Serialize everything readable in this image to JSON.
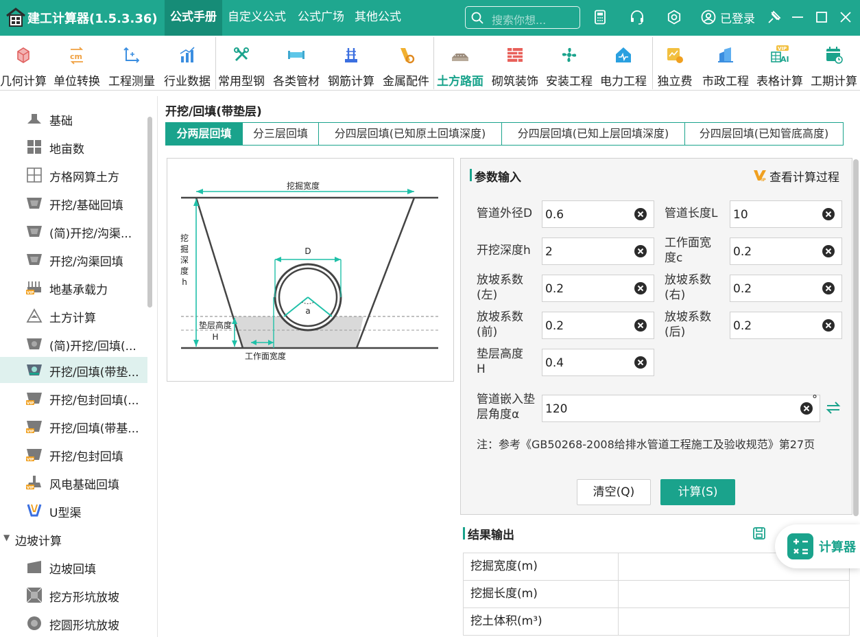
{
  "app": {
    "title": "建工计算器(1.5.3.36)"
  },
  "nav": {
    "tabs": [
      {
        "label": "公式手册"
      },
      {
        "label": "自定义公式"
      },
      {
        "label": "公式广场"
      },
      {
        "label": "其他公式"
      }
    ],
    "search_placeholder": "搜索你想...",
    "login_label": "已登录"
  },
  "toolbar": {
    "items": [
      {
        "label": "几何计算",
        "icon": "geometry-icon"
      },
      {
        "label": "单位转换",
        "icon": "unit-convert-icon"
      },
      {
        "label": "工程测量",
        "icon": "survey-icon"
      },
      {
        "label": "行业数据",
        "icon": "industry-data-icon"
      },
      {
        "label": "常用型钢",
        "icon": "steel-icon"
      },
      {
        "label": "各类管材",
        "icon": "pipe-icon"
      },
      {
        "label": "钢筋计算",
        "icon": "rebar-icon"
      },
      {
        "label": "金属配件",
        "icon": "metal-parts-icon"
      },
      {
        "label": "土方路面",
        "icon": "earthwork-icon"
      },
      {
        "label": "砌筑装饰",
        "icon": "masonry-icon"
      },
      {
        "label": "安装工程",
        "icon": "installation-icon"
      },
      {
        "label": "电力工程",
        "icon": "power-icon"
      },
      {
        "label": "独立费",
        "icon": "independent-fee-icon"
      },
      {
        "label": "市政工程",
        "icon": "municipal-icon"
      },
      {
        "label": "表格计算",
        "icon": "table-ai-icon"
      },
      {
        "label": "工期计算",
        "icon": "schedule-icon"
      }
    ],
    "active": "土方路面"
  },
  "sidebar": {
    "items": [
      {
        "label": "基础"
      },
      {
        "label": "地亩数"
      },
      {
        "label": "方格网算土方"
      },
      {
        "label": "开挖/基础回填"
      },
      {
        "label": "(简)开挖/沟渠..."
      },
      {
        "label": "开挖/沟渠回填"
      },
      {
        "label": "地基承载力"
      },
      {
        "label": "土方计算"
      },
      {
        "label": "(简)开挖/回填(..."
      },
      {
        "label": "开挖/回填(带垫..."
      },
      {
        "label": "开挖/包封回填(..."
      },
      {
        "label": "开挖/回填(带基..."
      },
      {
        "label": "开挖/包封回填"
      },
      {
        "label": "风电基础回填"
      },
      {
        "label": "U型渠"
      }
    ],
    "group": {
      "label": "边坡计算"
    },
    "group_items": [
      {
        "label": "边坡回填"
      },
      {
        "label": "挖方形坑放坡"
      },
      {
        "label": "挖圆形坑放坡"
      }
    ]
  },
  "page": {
    "title": "开挖/回填(带垫层)",
    "subtabs": [
      {
        "label": "分两层回填"
      },
      {
        "label": "分三层回填"
      },
      {
        "label": "分四层回填(已知原土回填深度)"
      },
      {
        "label": "分四层回填(已知上层回填深度)"
      },
      {
        "label": "分四层回填(已知管底高度)"
      }
    ]
  },
  "diagram": {
    "top_label": "挖掘宽度",
    "depth_label": "挖掘深度h",
    "depth_chars": [
      "挖",
      "掘",
      "深",
      "度",
      "h"
    ],
    "d_label": "D",
    "a_label": "a",
    "cushion_label_1": "垫层高度",
    "cushion_label_2": "H",
    "bottom_label": "工作面宽度"
  },
  "params": {
    "section_title": "参数输入",
    "view_process": "查看计算过程",
    "fields": [
      {
        "label": "管道外径D",
        "value": "0.6"
      },
      {
        "label": "管道长度L",
        "value": "10"
      },
      {
        "label": "开挖深度h",
        "value": "2"
      },
      {
        "label": "工作面宽度c",
        "value": "0.2"
      },
      {
        "label": "放坡系数(左)",
        "value": "0.2"
      },
      {
        "label": "放坡系数(右)",
        "value": "0.2"
      },
      {
        "label": "放坡系数(前)",
        "value": "0.2"
      },
      {
        "label": "放坡系数(后)",
        "value": "0.2"
      },
      {
        "label": "垫层高度H",
        "value": "0.4"
      },
      {
        "label": "管道嵌入垫层角度α",
        "value": "120"
      }
    ],
    "angle_unit": "°",
    "note": "注：参考《GB50268-2008给排水管道工程施工及验收规范》第27页",
    "clear_btn": "清空(Q)",
    "calc_btn": "计算(S)"
  },
  "results": {
    "section_title": "结果输出",
    "rows": [
      {
        "label": "挖掘宽度(m)",
        "value": ""
      },
      {
        "label": "挖掘长度(m)",
        "value": ""
      },
      {
        "label": "挖土体积(m³)",
        "value": ""
      }
    ]
  },
  "fab": {
    "label": "计算器"
  },
  "colors": {
    "brand": "#1fa78f",
    "accent": "#1aa38c"
  }
}
